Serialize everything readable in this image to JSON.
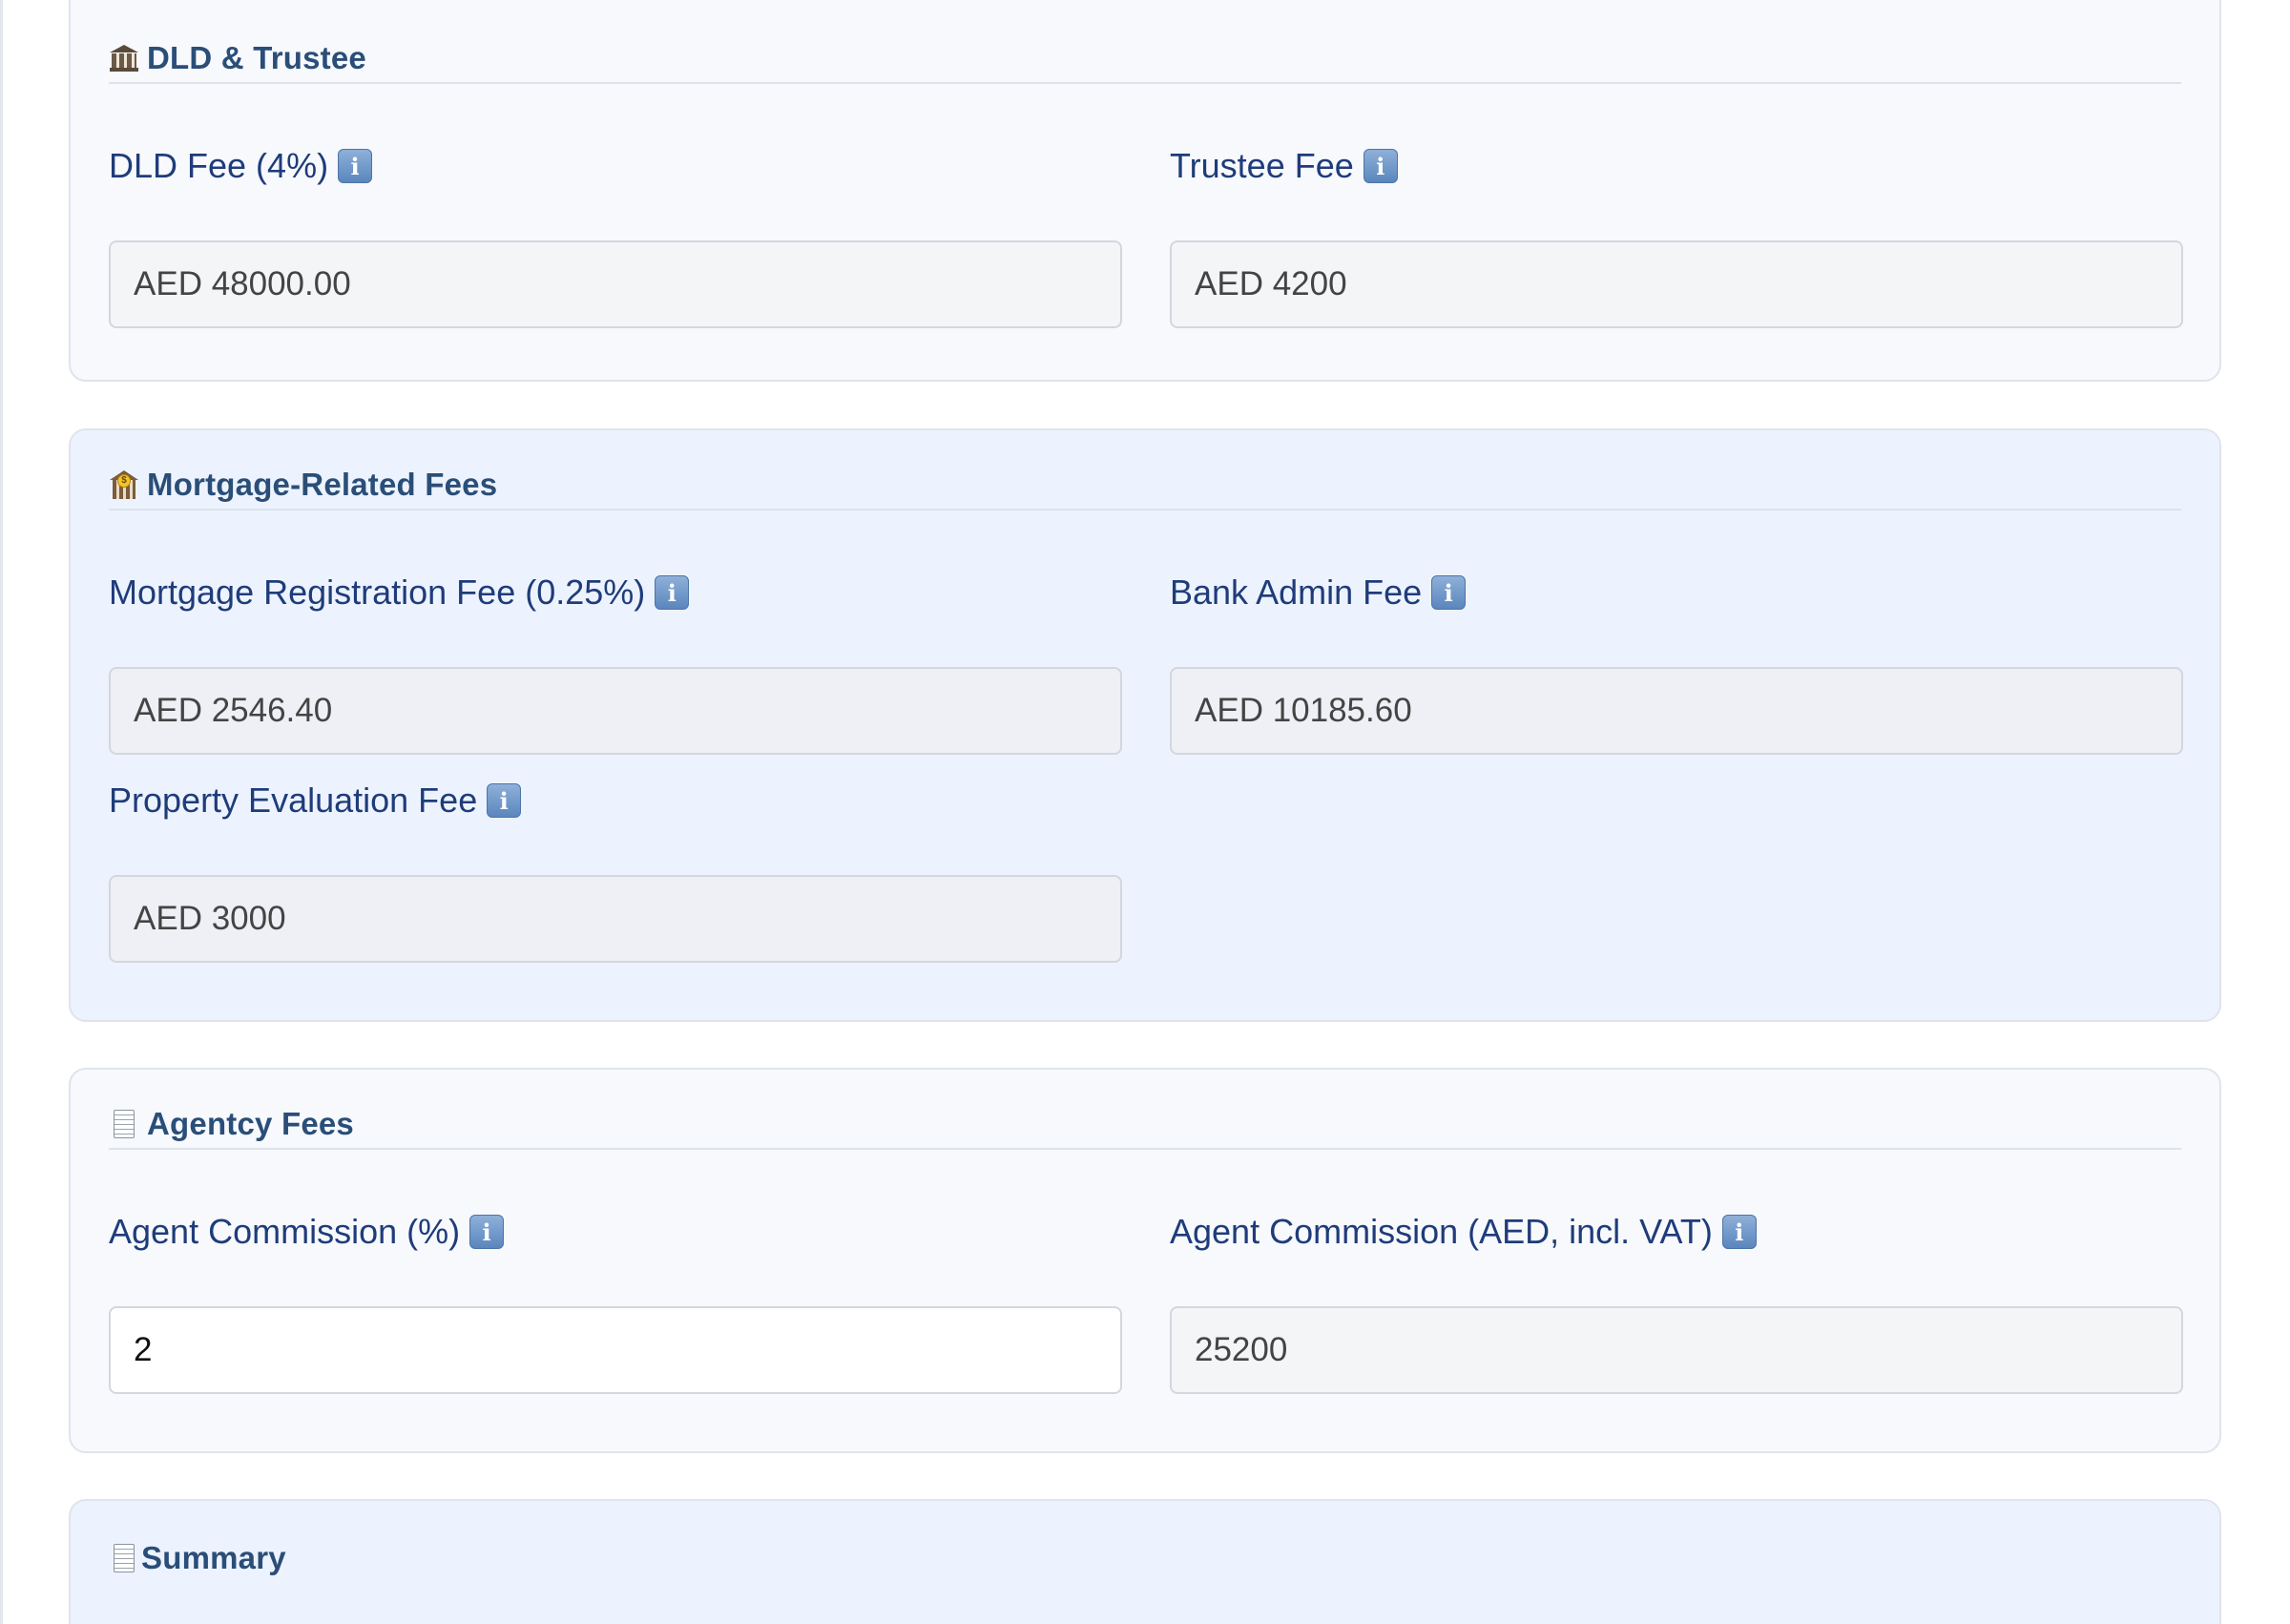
{
  "sections": {
    "dld": {
      "title": "DLD & Trustee",
      "icon": "bank-building-icon",
      "fields": {
        "dld_fee": {
          "label": "DLD Fee (4%)",
          "value": "AED 48000.00"
        },
        "trustee_fee": {
          "label": "Trustee Fee",
          "value": "AED 4200"
        }
      }
    },
    "mortgage": {
      "title": "Mortgage-Related Fees",
      "icon": "bank-money-icon",
      "fields": {
        "registration_fee": {
          "label": "Mortgage Registration Fee (0.25%)",
          "value": "AED 2546.40"
        },
        "bank_admin_fee": {
          "label": "Bank Admin Fee",
          "value": "AED 10185.60"
        },
        "evaluation_fee": {
          "label": "Property Evaluation Fee",
          "value": "AED 3000"
        }
      }
    },
    "agency": {
      "title": "Agentcy Fees",
      "icon": "receipt-icon",
      "fields": {
        "commission_pct": {
          "label": "Agent Commission (%)",
          "value": "2"
        },
        "commission_aed": {
          "label": "Agent Commission (AED, incl. VAT)",
          "value": "25200"
        }
      }
    },
    "summary": {
      "title": "Summary",
      "icon": "receipt-icon"
    }
  },
  "info_glyph": "i",
  "colors": {
    "section_title": "#2a4e78",
    "label": "#1f3c7a",
    "light_panel": "#f7f9fd",
    "blue_panel": "#edf3fe"
  }
}
